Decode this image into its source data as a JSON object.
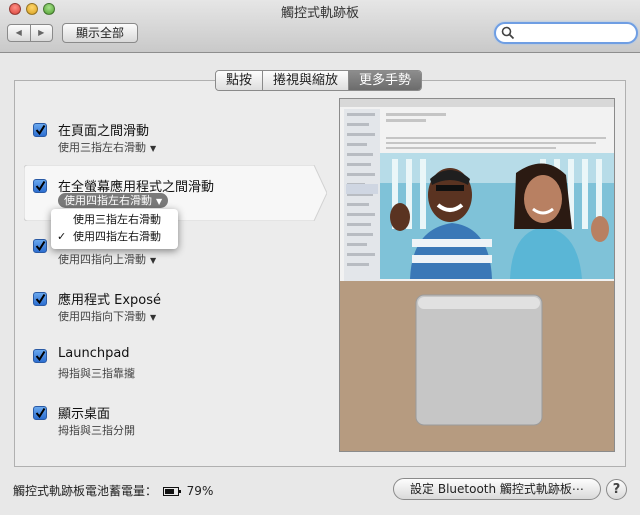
{
  "window": {
    "title": "觸控式軌跡板"
  },
  "toolbar": {
    "back_glyph": "◀",
    "forward_glyph": "▶",
    "show_all_label": "顯示全部",
    "search": {
      "value": "",
      "placeholder": ""
    }
  },
  "tabs": [
    {
      "label": "點按",
      "selected": false
    },
    {
      "label": "捲視與縮放",
      "selected": false
    },
    {
      "label": "更多手勢",
      "selected": true
    }
  ],
  "gestures": [
    {
      "title": "在頁面之間滑動",
      "option": "使用三指左右滑動",
      "checked": true
    },
    {
      "title": "在全螢幕應用程式之間滑動",
      "option": "使用四指左右滑動",
      "checked": true
    },
    {
      "title": "",
      "option": "使用四指向上滑動",
      "checked": true
    },
    {
      "title": "應用程式 Exposé",
      "option": "使用四指向下滑動",
      "checked": true
    },
    {
      "title": "Launchpad",
      "option": "拇指與三指靠攏",
      "checked": true
    },
    {
      "title": "顯示桌面",
      "option": "拇指與三指分開",
      "checked": true
    }
  ],
  "dropdown": {
    "options": [
      {
        "label": "使用三指左右滑動",
        "selected": false
      },
      {
        "label": "使用四指左右滑動",
        "selected": true
      }
    ]
  },
  "footer": {
    "battery_label": "觸控式軌跡板電池蓄電量：",
    "battery_level": "79%",
    "battery_fraction": 0.79,
    "setup_button_label": "設定 Bluetooth 觸控式軌跡板⋯",
    "help_label": "?"
  },
  "colors": {
    "checkbox": "#2d6fd1",
    "selected_tab": "#6c6c6c",
    "search_ring": "#6f9ee3"
  },
  "icons": {
    "checkbox": "checkmark-icon",
    "search": "magnifier-icon",
    "battery": "battery-icon"
  }
}
